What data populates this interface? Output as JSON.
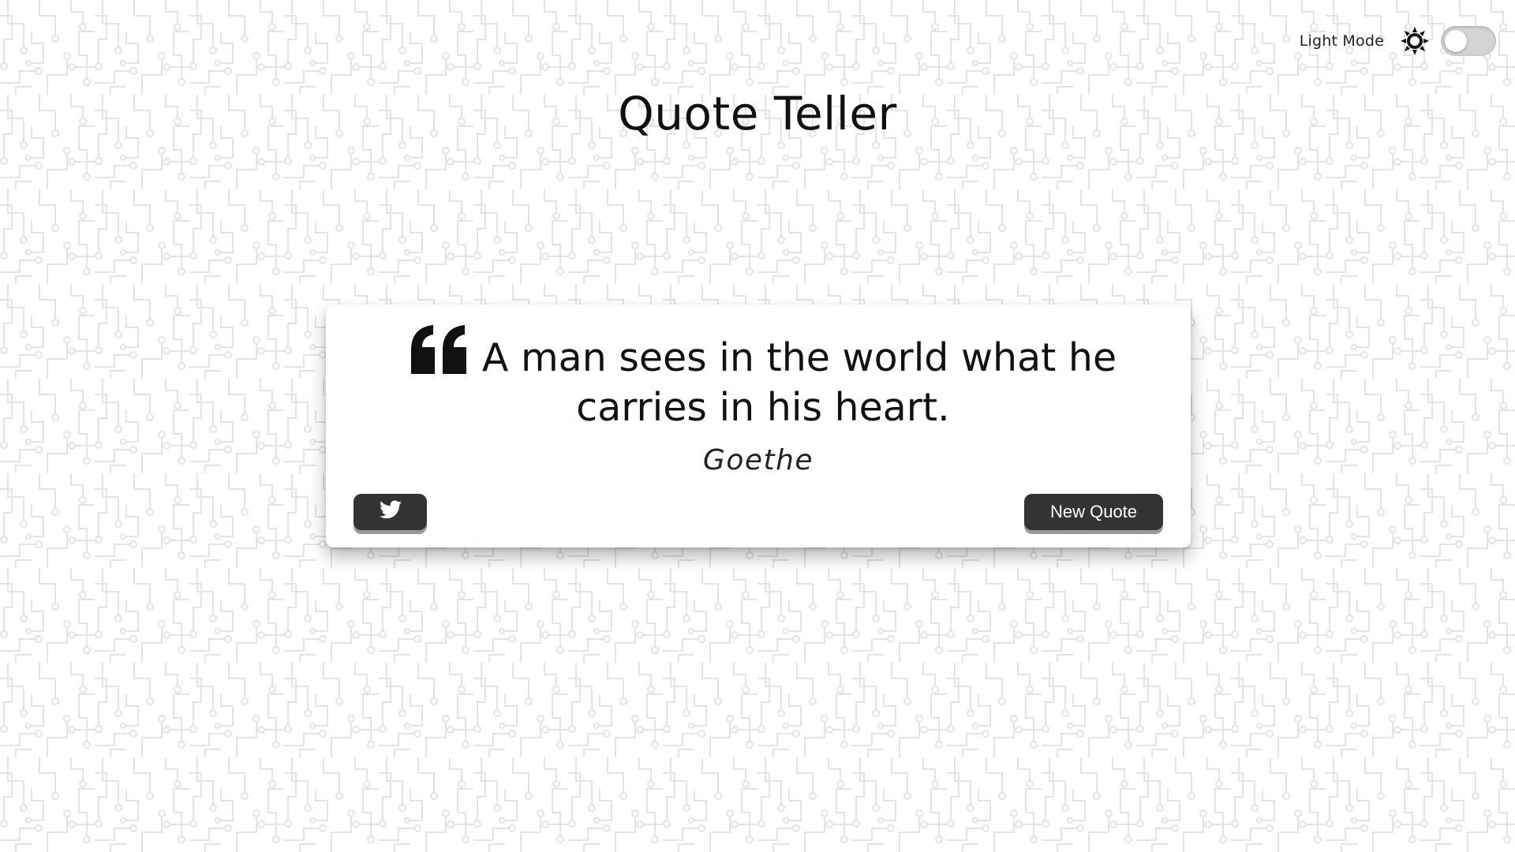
{
  "theme_switch": {
    "label": "Light Mode",
    "icon": "sun-icon",
    "checked": false
  },
  "header": {
    "title": "Quote Teller"
  },
  "quote": {
    "text": "A man sees in the world what he carries in his heart.",
    "author": "Goethe",
    "quote_icon": "quote-left-icon"
  },
  "actions": {
    "twitter_icon": "twitter-icon",
    "new_quote_label": "New Quote"
  },
  "colors": {
    "background": "#ffffff",
    "circuit_pattern": "#e6e6e6",
    "button_bg": "#333333",
    "button_shadow": "#9a9a9a",
    "text": "#111111"
  }
}
